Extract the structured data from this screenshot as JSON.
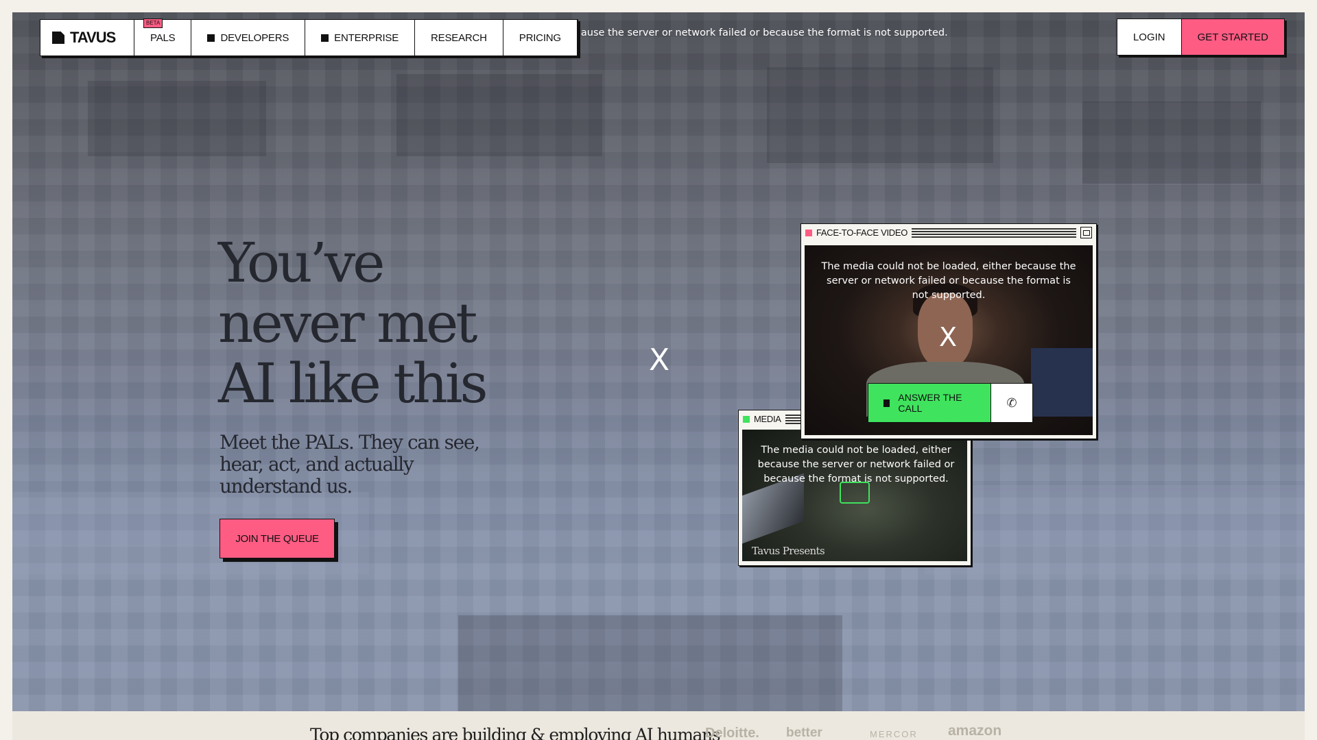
{
  "header": {
    "logo_text": "TAVUS",
    "beta_badge": "BETA",
    "nav_items": [
      {
        "label": "PALS"
      },
      {
        "label": "DEVELOPERS",
        "icon": "square-icon"
      },
      {
        "label": "ENTERPRISE",
        "icon": "square-icon"
      },
      {
        "label": "RESEARCH"
      },
      {
        "label": "PRICING"
      }
    ],
    "login_label": "LOGIN",
    "get_started_label": "GET STARTED"
  },
  "background_media_error": "ecause the server or network failed or because the format is not supported.",
  "hero": {
    "title": "You’ve never met AI like this",
    "subtitle": "Meet the PALs. They can see, hear, act, and actually understand us.",
    "cta_label": "JOIN THE QUEUE",
    "close_glyph": "X"
  },
  "video_window": {
    "title": "FACE-TO-FACE VIDEO",
    "error_text": "The media could not be loaded, either because the server or network failed or because the format is not supported.",
    "close_glyph": "X",
    "answer_label": "ANSWER THE CALL",
    "phone_icon": "phone-icon"
  },
  "media_window": {
    "title": "MEDIA",
    "error_text": "The media could not be loaded, either because the server or network failed or because the format is not supported.",
    "overlay_text": "Tavus Presents"
  },
  "bottom": {
    "heading": "Top companies are building & employing AI humans",
    "brands": [
      "Deloitte.",
      "better",
      "MERCOR",
      "amazon"
    ]
  },
  "colors": {
    "accent_pink": "#ff5c84",
    "accent_green": "#3fe35d",
    "ink": "#111111"
  }
}
